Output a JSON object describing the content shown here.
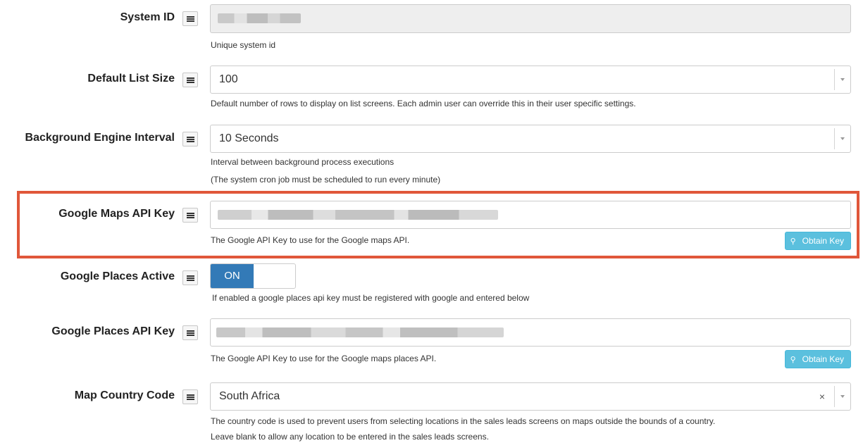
{
  "settings": {
    "system_id": {
      "label": "System ID",
      "help": "Unique system id"
    },
    "default_list_size": {
      "label": "Default List Size",
      "value": "100",
      "help": "Default number of rows to display on list screens. Each admin user can override this in their user specific settings."
    },
    "background_engine_interval": {
      "label": "Background Engine Interval",
      "value": "10 Seconds",
      "help_line1": "Interval between background process executions",
      "help_line2": "(The system cron job must be scheduled to run every minute)"
    },
    "google_maps_api_key": {
      "label": "Google Maps API Key",
      "help": "The Google API Key to use for the Google maps API.",
      "button": "Obtain Key"
    },
    "google_places_active": {
      "label": "Google Places Active",
      "toggle": "ON",
      "help": "If enabled a google places api key must be registered with google and entered below"
    },
    "google_places_api_key": {
      "label": "Google Places API Key",
      "help": "The Google API Key to use for the Google maps places API.",
      "button": "Obtain Key"
    },
    "map_country_code": {
      "label": "Map Country Code",
      "value": "South Africa",
      "clear": "×",
      "help_line1": "The country code is used to prevent users from selecting locations in the sales leads screens on maps outside the bounds of a country.",
      "help_line2": "Leave blank to allow any location to be entered in the sales leads screens."
    }
  },
  "icons": {
    "menu": "hamburger-menu-icon",
    "key": "key-icon",
    "dropdown": "chevron-down-icon"
  },
  "colors": {
    "highlight": "#e0573a",
    "info_button": "#5bc0de",
    "toggle_on": "#337ab7",
    "disabled_field": "#eeeeee"
  }
}
